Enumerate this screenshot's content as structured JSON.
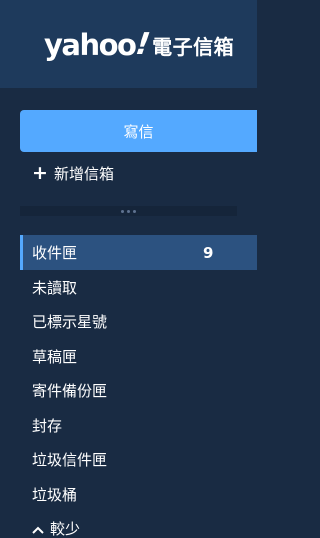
{
  "brand": {
    "logo_word": "yahoo",
    "logo_mark": "!",
    "logo_cn": "電子信箱"
  },
  "compose": {
    "label": "寫信"
  },
  "new_folder": {
    "label": "新增信箱",
    "icon": "plus-icon"
  },
  "folders": [
    {
      "label": "收件匣",
      "count": "9",
      "active": true
    },
    {
      "label": "未讀取"
    },
    {
      "label": "已標示星號"
    },
    {
      "label": "草稿匣"
    },
    {
      "label": "寄件備份匣"
    },
    {
      "label": "封存"
    },
    {
      "label": "垃圾信件匣"
    },
    {
      "label": "垃圾桶"
    }
  ],
  "less_toggle": {
    "label": "較少",
    "icon": "chevron-up-icon"
  },
  "colors": {
    "sidebar_bg": "#192b43",
    "header_bg": "#1e3a5c",
    "compose_bg": "#54a9ff",
    "active_bg": "#2c5280"
  }
}
